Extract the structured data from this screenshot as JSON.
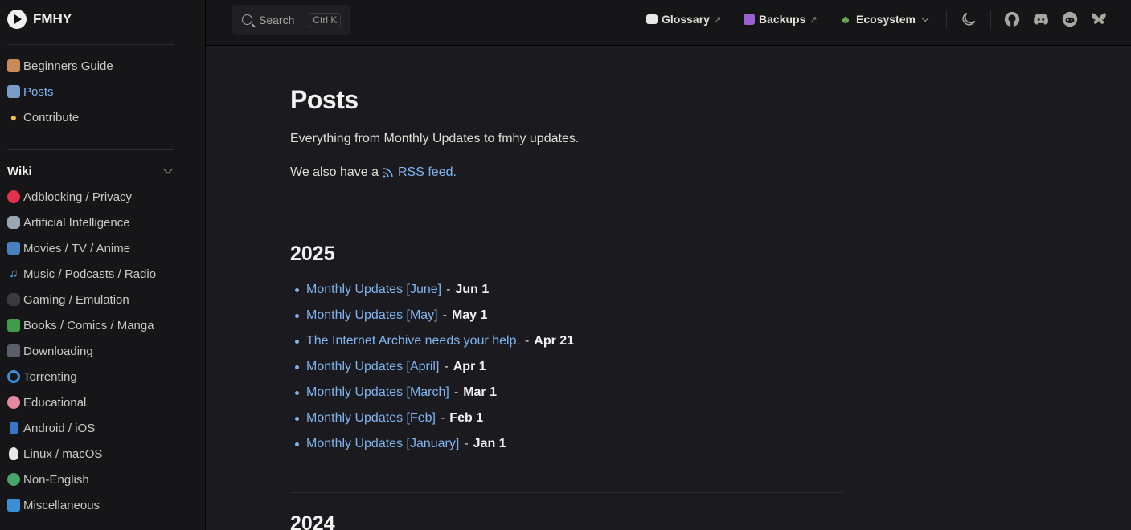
{
  "brand": {
    "name": "FMHY"
  },
  "sidebar": {
    "top_items": [
      {
        "label": "Beginners Guide",
        "icon": "books-icon",
        "color": "#c98a5a"
      },
      {
        "label": "Posts",
        "icon": "page-icon",
        "color": "#7a9cc6"
      },
      {
        "label": "Contribute",
        "icon": "lightbulb-icon",
        "color": "#f2c14e"
      }
    ],
    "wiki_heading": "Wiki",
    "wiki_items": [
      {
        "label": "Adblocking / Privacy",
        "icon": "stop-icon",
        "color": "#e0334a"
      },
      {
        "label": "Artificial Intelligence",
        "icon": "robot-icon",
        "color": "#9aa6b2"
      },
      {
        "label": "Movies / TV / Anime",
        "icon": "tv-icon",
        "color": "#4a7fc1"
      },
      {
        "label": "Music / Podcasts / Radio",
        "icon": "music-note-icon",
        "color": "#5aa9e6"
      },
      {
        "label": "Gaming / Emulation",
        "icon": "gamepad-icon",
        "color": "#7a7a80"
      },
      {
        "label": "Books / Comics / Manga",
        "icon": "green-book-icon",
        "color": "#3f9a4a"
      },
      {
        "label": "Downloading",
        "icon": "floppy-icon",
        "color": "#5a5f6a"
      },
      {
        "label": "Torrenting",
        "icon": "cyclone-icon",
        "color": "#3c8fd9"
      },
      {
        "label": "Educational",
        "icon": "brain-icon",
        "color": "#e58aa0"
      },
      {
        "label": "Android / iOS",
        "icon": "phone-icon",
        "color": "#3a74c4"
      },
      {
        "label": "Linux / macOS",
        "icon": "penguin-icon",
        "color": "#e8e8e8"
      },
      {
        "label": "Non-English",
        "icon": "globe-icon",
        "color": "#4aa36a"
      },
      {
        "label": "Miscellaneous",
        "icon": "folder-icon",
        "color": "#3b8fd6"
      }
    ]
  },
  "topbar": {
    "search_label": "Search",
    "search_shortcut": "Ctrl K",
    "links": [
      {
        "label": "Glossary",
        "icon": "book-icon",
        "color": "#e8e8e8",
        "external": "↗"
      },
      {
        "label": "Backups",
        "icon": "floppy-icon",
        "color": "#9b5fd1",
        "external": "↗"
      }
    ],
    "ecosystem_label": "Ecosystem",
    "ecosystem_icon_color": "#6ab04c"
  },
  "main": {
    "title": "Posts",
    "intro": "Everything from Monthly Updates to fmhy updates.",
    "rss_prefix": "We also have a",
    "rss_link": "RSS feed.",
    "years": [
      {
        "year": "2025",
        "posts": [
          {
            "title": "Monthly Updates [June]",
            "date": "Jun 1"
          },
          {
            "title": "Monthly Updates [May]",
            "date": "May 1"
          },
          {
            "title": "The Internet Archive needs your help.",
            "date": "Apr 21"
          },
          {
            "title": "Monthly Updates [April]",
            "date": "Apr 1"
          },
          {
            "title": "Monthly Updates [March]",
            "date": "Mar 1"
          },
          {
            "title": "Monthly Updates [Feb]",
            "date": "Feb 1"
          },
          {
            "title": "Monthly Updates [January]",
            "date": "Jan 1"
          }
        ]
      },
      {
        "year": "2024"
      }
    ]
  },
  "colors": {
    "accent": "#7fb4f0",
    "background": "#1b1b1f",
    "sidebar": "#161618"
  }
}
